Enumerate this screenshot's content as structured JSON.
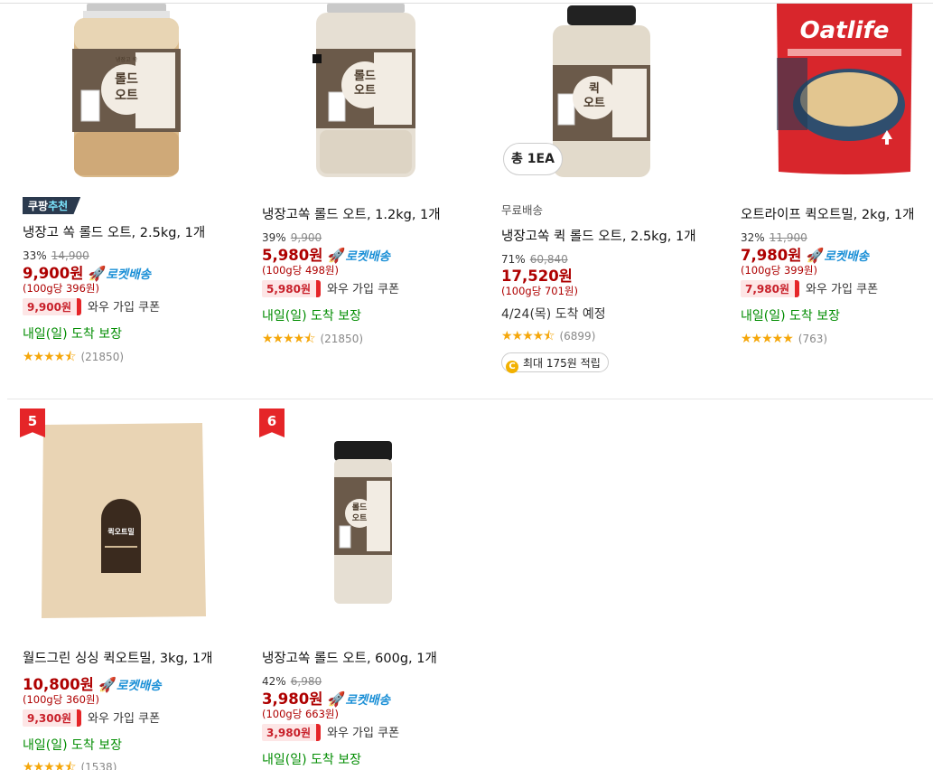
{
  "products": [
    {
      "name": "냉장고 쏙 롤드 오트, 2.5kg, 1개",
      "badge_brand": "쿠팡",
      "badge_rec": "추천",
      "discount": "33%",
      "original_price": "14,900",
      "price": "9,900원",
      "rocket": "로켓배송",
      "unit_price": "(100g당 396원)",
      "coupon_price": "9,900원",
      "coupon_text": "와우 가입 쿠폰",
      "delivery": "내일(일) 도착 보장",
      "rating": 4.5,
      "reviews": "(21850)",
      "label_line1": "롤드",
      "label_line2": "오트",
      "label_brand": "냉장고 쏙"
    },
    {
      "name": "냉장고쏙 롤드 오트, 1.2kg, 1개",
      "discount": "39%",
      "original_price": "9,900",
      "price": "5,980원",
      "rocket": "로켓배송",
      "unit_price": "(100g당 498원)",
      "coupon_price": "5,980원",
      "coupon_text": "와우 가입 쿠폰",
      "delivery": "내일(일) 도착 보장",
      "rating": 4.5,
      "reviews": "(21850)",
      "label_line1": "롤드",
      "label_line2": "오트"
    },
    {
      "name": "냉장고쏙 퀵 롤드 오트, 2.5kg, 1개",
      "free_shipping": "무료배송",
      "qty_badge": "총 1EA",
      "discount": "71%",
      "original_price": "60,840",
      "price": "17,520원",
      "unit_price": "(100g당 701원)",
      "delivery": "4/24(목) 도착 예정",
      "rating": 4.5,
      "reviews": "(6899)",
      "cash_icon": "C",
      "cashback": "최대 175원 적립",
      "label_line1": "퀵",
      "label_line2": "오트"
    },
    {
      "name": "오트라이프 퀵오트밀, 2kg, 1개",
      "discount": "32%",
      "original_price": "11,900",
      "price": "7,980원",
      "rocket": "로켓배송",
      "unit_price": "(100g당 399원)",
      "coupon_price": "7,980원",
      "coupon_text": "와우 가입 쿠폰",
      "delivery": "내일(일) 도착 보장",
      "rating": 5,
      "reviews": "(763)",
      "brand_logo": "Oatlife"
    },
    {
      "rank": "5",
      "name": "월드그린 싱싱 퀵오트밀, 3kg, 1개",
      "price": "10,800원",
      "rocket": "로켓배송",
      "unit_price": "(100g당 360원)",
      "coupon_price": "9,300원",
      "coupon_text": "와우 가입 쿠폰",
      "delivery": "내일(일) 도착 보장",
      "rating": 4.5,
      "reviews": "(1538)",
      "label_text": "퀵오트밀"
    },
    {
      "rank": "6",
      "name": "냉장고쏙 롤드 오트, 600g, 1개",
      "discount": "42%",
      "original_price": "6,980",
      "price": "3,980원",
      "rocket": "로켓배송",
      "unit_price": "(100g당 663원)",
      "coupon_price": "3,980원",
      "coupon_text": "와우 가입 쿠폰",
      "delivery": "내일(일) 도착 보장",
      "label_line1": "롤드",
      "label_line2": "오트"
    }
  ],
  "icons": {
    "rocket": "rocket-icon",
    "star": "star-icon",
    "coin": "coin-icon"
  },
  "colors": {
    "price": "#ae0000",
    "rocket": "#1a8fd6",
    "delivery": "#008c00",
    "star": "#f5a70b",
    "rank": "#e52528"
  }
}
